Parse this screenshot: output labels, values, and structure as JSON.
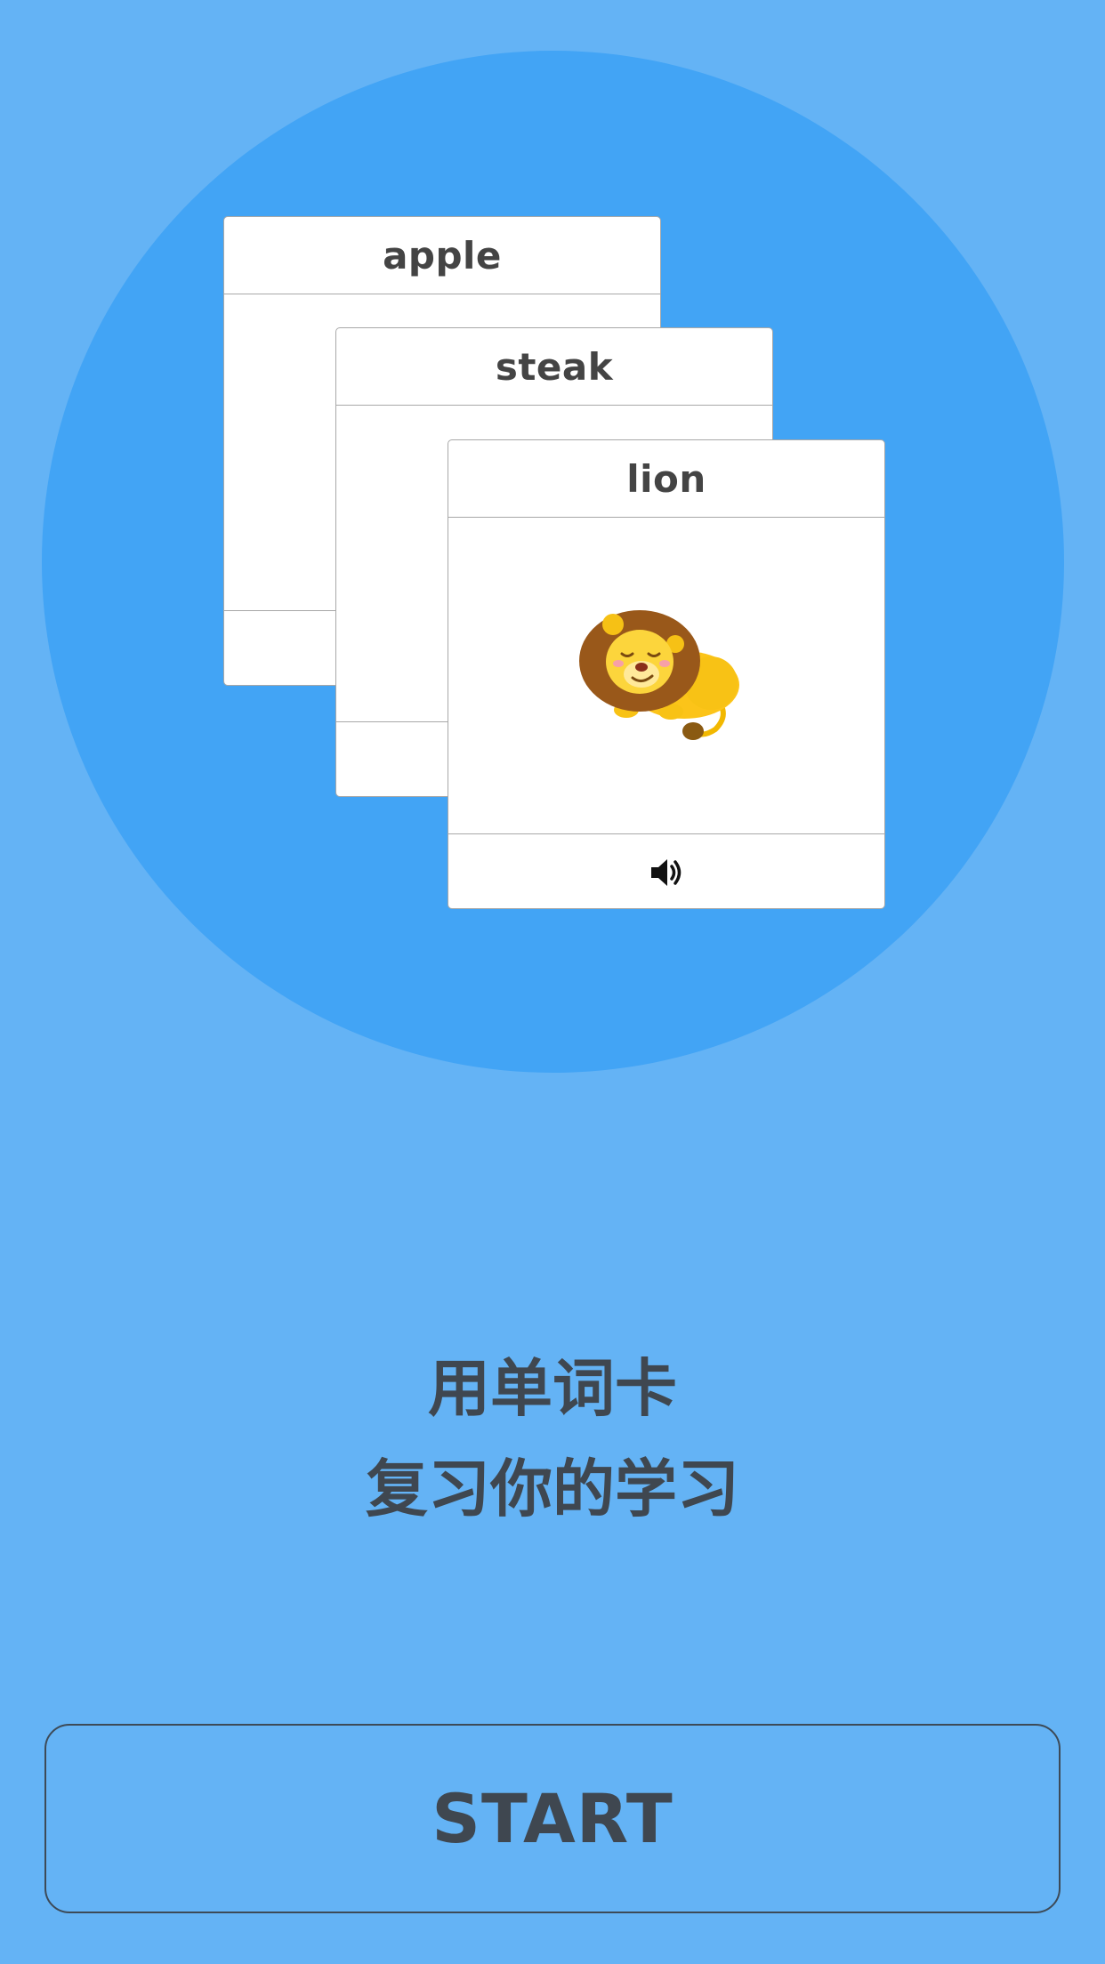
{
  "cards": [
    {
      "word": "apple"
    },
    {
      "word": "steak"
    },
    {
      "word": "lion"
    }
  ],
  "tagline": {
    "line1": "用单词卡",
    "line2": "复习你的学习"
  },
  "start_button": {
    "label": "START"
  },
  "icons": {
    "card_image": "lion-illustration",
    "audio": "speaker-icon"
  },
  "colors": {
    "background": "#64b3f5",
    "circle": "#42a4f5",
    "text": "#3f4750"
  }
}
